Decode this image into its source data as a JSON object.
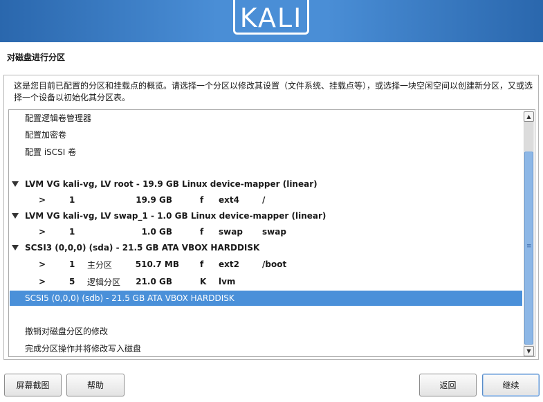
{
  "banner": {
    "logo_text": "KALI"
  },
  "step_title": "对磁盘进行分区",
  "description": "这是您目前已配置的分区和挂载点的概览。请选择一个分区以修改其设置（文件系统、挂载点等），或选择一块空闲空间以创建新分区，又或选择一个设备以初始化其分区表。",
  "partition_list": {
    "items": [
      {
        "label": "配置逻辑卷管理器"
      },
      {
        "label": "配置加密卷"
      },
      {
        "label": "配置 iSCSI 卷"
      },
      {
        "label": "LVM VG kali-vg, LV root - 19.9 GB Linux device-mapper (linear)"
      },
      {
        "arrow": ">",
        "num": "1",
        "type": "",
        "size": "19.9 GB",
        "flag": "f",
        "fs": "ext4",
        "mount": "/"
      },
      {
        "label": "LVM VG kali-vg, LV swap_1 - 1.0 GB Linux device-mapper (linear)"
      },
      {
        "arrow": ">",
        "num": "1",
        "type": "",
        "size": "1.0 GB",
        "flag": "f",
        "fs": "swap",
        "mount": "swap"
      },
      {
        "label": "SCSI3 (0,0,0) (sda) - 21.5 GB ATA VBOX HARDDISK"
      },
      {
        "arrow": ">",
        "num": "1",
        "type": "主分区",
        "size": "510.7 MB",
        "flag": "f",
        "fs": "ext2",
        "mount": "/boot"
      },
      {
        "arrow": ">",
        "num": "5",
        "type": "逻辑分区",
        "size": "21.0 GB",
        "flag": "K",
        "fs": "lvm",
        "mount": ""
      },
      {
        "label": "SCSI5 (0,0,0) (sdb) - 21.5 GB ATA VBOX HARDDISK",
        "selected": true
      },
      {
        "label": "撤销对磁盘分区的修改"
      },
      {
        "label": "完成分区操作并将修改写入磁盘"
      }
    ]
  },
  "scrollbar": {
    "up_arrow": "▲",
    "down_arrow": "▼",
    "grip": "≡"
  },
  "buttons": {
    "screenshot": "屏幕截图",
    "help": "帮助",
    "back": "返回",
    "continue": "继续"
  },
  "colors": {
    "selection": "#4a90d9",
    "banner": "#3a7bc8"
  }
}
